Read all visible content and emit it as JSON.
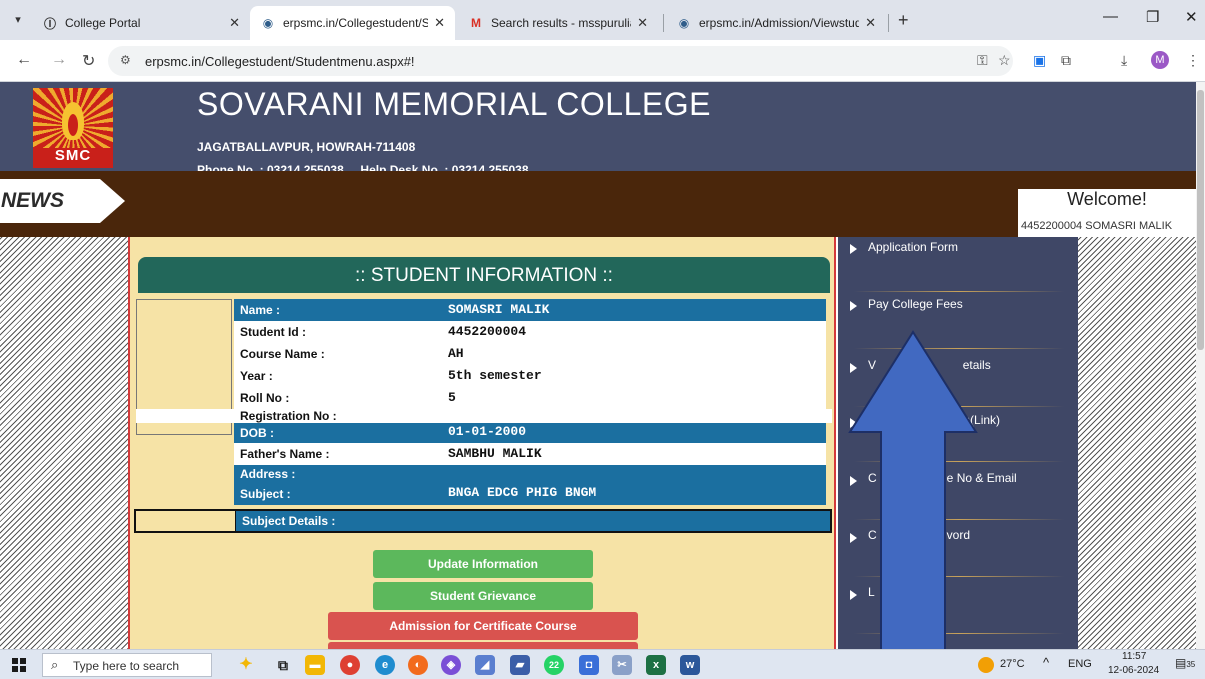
{
  "browser": {
    "tabs": [
      {
        "title": "College Portal"
      },
      {
        "title": "erpsmc.in/Collegestudent/Stud"
      },
      {
        "title": "Search results - msspurulia@gn"
      },
      {
        "title": "erpsmc.in/Admission/Viewstud"
      }
    ],
    "url": "erpsmc.in/Collegestudent/Studentmenu.aspx#!",
    "profile_initial": "M"
  },
  "header": {
    "logo_text": "SMC",
    "college_name": "SOVARANI MEMORIAL COLLEGE",
    "address": "JAGATBALLAVPUR, HOWRAH-711408",
    "phones": "Phone No. : 03214 255038     Help Desk No. : 03214 255038"
  },
  "news": {
    "label": "NEWS",
    "welcome": "Welcome!",
    "user": "4452200004 SOMASRI MALIK"
  },
  "student_info": {
    "title": ":: STUDENT INFORMATION ::",
    "rows": [
      {
        "label": "Name :",
        "value": "SOMASRI MALIK"
      },
      {
        "label": "Student Id :",
        "value": "4452200004"
      },
      {
        "label": "Course Name :",
        "value": "AH"
      },
      {
        "label": "Year :",
        "value": "5th semester"
      },
      {
        "label": "Roll No :",
        "value": "5"
      },
      {
        "label": "Registration No :",
        "value": ""
      },
      {
        "label": "DOB :",
        "value": "01-01-2000"
      },
      {
        "label": "Father's Name :",
        "value": "SAMBHU MALIK"
      },
      {
        "label": "Address :",
        "value": ""
      },
      {
        "label": "Subject :",
        "value": "BNGA EDCG PHIG BNGM"
      },
      {
        "label": "Subject Details :",
        "value": ""
      }
    ]
  },
  "buttons": {
    "update": "Update Information",
    "grievance": "Student Grievance",
    "admission_cert": "Admission for Certificate Course"
  },
  "side_menu": {
    "items": [
      {
        "label": "Application Form"
      },
      {
        "label": "Pay College Fees"
      },
      {
        "label": "V                          etails"
      },
      {
        "label": "C                     oom(Link)"
      },
      {
        "label": "C                     e No & Email"
      },
      {
        "label": "C                     vord"
      },
      {
        "label": "L"
      }
    ]
  },
  "taskbar": {
    "search_placeholder": "Type here to search",
    "weather": "27°C",
    "lang": "ENG",
    "time": "11:57",
    "date": "12-06-2024",
    "notif_count": "35",
    "whatsapp_badge": "22"
  },
  "colors": {
    "header_bg": "#454e6c",
    "news_bg": "#4a260b",
    "content_bg": "#f6e3a6",
    "row_dark": "#1b6fa0",
    "title_bar": "#22675a",
    "menu_bg": "#3f4766",
    "arrow": "#4169c1"
  }
}
